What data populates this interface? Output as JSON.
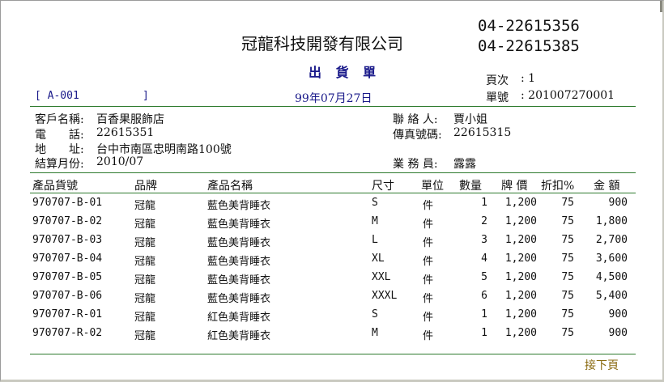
{
  "header": {
    "company": "冠龍科技開發有限公司",
    "phone1": "04-22615356",
    "phone2": "04-22615385",
    "title": "出 貨 單",
    "page_label": "頁次",
    "page_value": ": 1",
    "doc_no_label": "單號",
    "doc_no_value": ": 201007270001",
    "ref_code": "[ A-001          ]",
    "date": "99年07月27日"
  },
  "customer": {
    "name_label": "客戶名稱:",
    "name": "百香果服飾店",
    "phone_label": "電　　話:",
    "phone": "22615351",
    "address_label": "地　　址:",
    "address": "台中市南區忠明南路100號",
    "month_label": "結算月份:",
    "month": "2010/07",
    "contact_label": "聯 絡 人:",
    "contact": "賈小姐",
    "fax_label": "傳真號碼:",
    "fax": "22615315",
    "sales_label": "業 務 員:",
    "sales": "露露"
  },
  "table": {
    "headers": [
      "產品貨號",
      "品牌",
      "產品名稱",
      "尺寸",
      "單位",
      "數量",
      "牌 價",
      "折扣%",
      "金 額"
    ],
    "rows": [
      [
        "970707-B-01",
        "冠龍",
        "藍色美背睡衣",
        "S",
        "件",
        "1",
        "1,200",
        "75",
        "900"
      ],
      [
        "970707-B-02",
        "冠龍",
        "藍色美背睡衣",
        "M",
        "件",
        "2",
        "1,200",
        "75",
        "1,800"
      ],
      [
        "970707-B-03",
        "冠龍",
        "藍色美背睡衣",
        "L",
        "件",
        "3",
        "1,200",
        "75",
        "2,700"
      ],
      [
        "970707-B-04",
        "冠龍",
        "藍色美背睡衣",
        "XL",
        "件",
        "4",
        "1,200",
        "75",
        "3,600"
      ],
      [
        "970707-B-05",
        "冠龍",
        "藍色美背睡衣",
        "XXL",
        "件",
        "5",
        "1,200",
        "75",
        "4,500"
      ],
      [
        "970707-B-06",
        "冠龍",
        "藍色美背睡衣",
        "XXXL",
        "件",
        "6",
        "1,200",
        "75",
        "5,400"
      ],
      [
        "970707-R-01",
        "冠龍",
        "紅色美背睡衣",
        "S",
        "件",
        "1",
        "1,200",
        "75",
        "900"
      ],
      [
        "970707-R-02",
        "冠龍",
        "紅色美背睡衣",
        "M",
        "件",
        "1",
        "1,200",
        "75",
        "900"
      ]
    ]
  },
  "footer": {
    "next_page": "接下頁"
  },
  "colors": {
    "rule": "#2e7a2e",
    "title": "#1a1a8a",
    "link": "#8a6a10"
  }
}
